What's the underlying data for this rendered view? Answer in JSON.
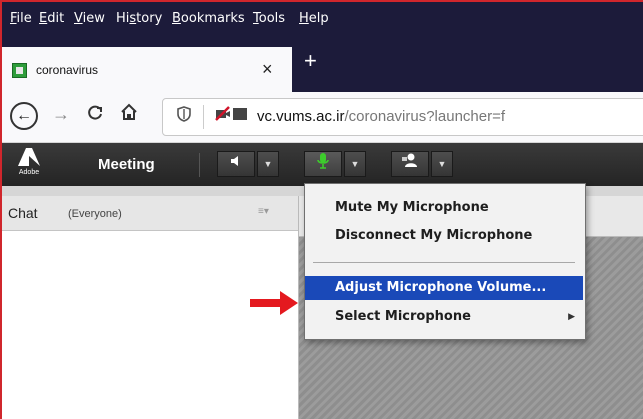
{
  "menubar": {
    "items": [
      {
        "label": "File",
        "u": "F",
        "rest": "ile"
      },
      {
        "label": "Edit",
        "u": "E",
        "rest": "dit"
      },
      {
        "label": "View",
        "u": "V",
        "rest": "iew"
      },
      {
        "label": "History",
        "pre": "Hi",
        "u": "s",
        "rest": "tory"
      },
      {
        "label": "Bookmarks",
        "u": "B",
        "rest": "ookmarks"
      },
      {
        "label": "Tools",
        "u": "T",
        "rest": "ools"
      },
      {
        "label": "Help",
        "u": "H",
        "rest": "elp"
      }
    ]
  },
  "tab": {
    "title": "coronavirus",
    "close": "×",
    "new_tab": "+"
  },
  "nav": {
    "back": "←",
    "forward": "→",
    "reload": "C",
    "home": "⌂",
    "url_domain": "vc.vums.ac.ir",
    "url_path": "/coronavirus?launcher=f"
  },
  "adobe": {
    "logo_text": "Adobe",
    "meeting_label": "Meeting"
  },
  "chat": {
    "title": "Chat",
    "subtitle": "(Everyone)",
    "menu": "≡▾"
  },
  "mic_menu": {
    "items": [
      {
        "label": "Mute My Microphone"
      },
      {
        "label": "Disconnect My Microphone"
      },
      {
        "label": "Adjust Microphone Volume..."
      },
      {
        "label": "Select Microphone",
        "submenu": "▶"
      }
    ]
  },
  "colors": {
    "menubar_bg": "#1c1b3a",
    "highlight": "#1a49b8",
    "mic_green": "#3dcc2c",
    "arrow_red": "#e4191f"
  }
}
